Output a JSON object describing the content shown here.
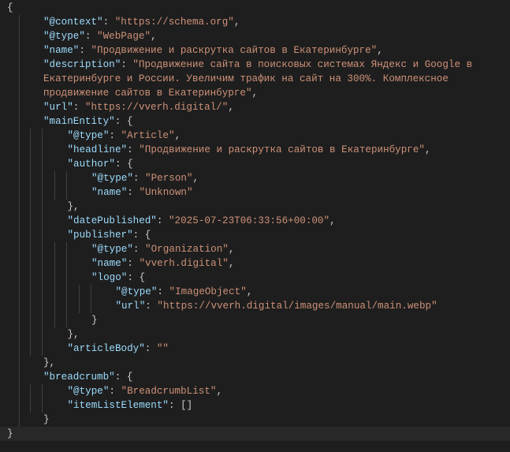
{
  "editor": {
    "current_line": 30,
    "lines": [
      {
        "level": 0,
        "seg": [
          [
            "p",
            "{"
          ]
        ]
      },
      {
        "level": 1,
        "seg": [
          [
            "k",
            "\"@context\""
          ],
          [
            "p",
            ": "
          ],
          [
            "s",
            "\"https://schema.org\""
          ],
          [
            "p",
            ","
          ]
        ]
      },
      {
        "level": 1,
        "seg": [
          [
            "k",
            "\"@type\""
          ],
          [
            "p",
            ": "
          ],
          [
            "s",
            "\"WebPage\""
          ],
          [
            "p",
            ","
          ]
        ]
      },
      {
        "level": 1,
        "seg": [
          [
            "k",
            "\"name\""
          ],
          [
            "p",
            ": "
          ],
          [
            "s",
            "\"Продвижение и раскрутка сайтов в Екатеринбурге\""
          ],
          [
            "p",
            ","
          ]
        ]
      },
      {
        "level": 1,
        "seg": [
          [
            "k",
            "\"description\""
          ],
          [
            "p",
            ": "
          ],
          [
            "s",
            "\"Продвижение сайта в поисковых системах Яндекс и Google в"
          ]
        ]
      },
      {
        "level": 1,
        "seg": [
          [
            "s",
            "Екатеринбурге и России. Увеличим трафик на сайт на 300%. Комплексное"
          ]
        ]
      },
      {
        "level": 1,
        "seg": [
          [
            "s",
            "продвижение сайтов в Екатеринбурге\""
          ],
          [
            "p",
            ","
          ]
        ]
      },
      {
        "level": 1,
        "seg": [
          [
            "k",
            "\"url\""
          ],
          [
            "p",
            ": "
          ],
          [
            "s",
            "\"https://vverh.digital/\""
          ],
          [
            "p",
            ","
          ]
        ]
      },
      {
        "level": 1,
        "seg": [
          [
            "k",
            "\"mainEntity\""
          ],
          [
            "p",
            ": {"
          ]
        ]
      },
      {
        "level": 2,
        "seg": [
          [
            "k",
            "\"@type\""
          ],
          [
            "p",
            ": "
          ],
          [
            "s",
            "\"Article\""
          ],
          [
            "p",
            ","
          ]
        ]
      },
      {
        "level": 2,
        "seg": [
          [
            "k",
            "\"headline\""
          ],
          [
            "p",
            ": "
          ],
          [
            "s",
            "\"Продвижение и раскрутка сайтов в Екатеринбурге\""
          ],
          [
            "p",
            ","
          ]
        ]
      },
      {
        "level": 2,
        "seg": [
          [
            "k",
            "\"author\""
          ],
          [
            "p",
            ": {"
          ]
        ]
      },
      {
        "level": 3,
        "seg": [
          [
            "k",
            "\"@type\""
          ],
          [
            "p",
            ": "
          ],
          [
            "s",
            "\"Person\""
          ],
          [
            "p",
            ","
          ]
        ]
      },
      {
        "level": 3,
        "seg": [
          [
            "k",
            "\"name\""
          ],
          [
            "p",
            ": "
          ],
          [
            "s",
            "\"Unknown\""
          ]
        ]
      },
      {
        "level": 2,
        "seg": [
          [
            "p",
            "},"
          ]
        ]
      },
      {
        "level": 2,
        "seg": [
          [
            "k",
            "\"datePublished\""
          ],
          [
            "p",
            ": "
          ],
          [
            "s",
            "\"2025-07-23T06:33:56+00:00\""
          ],
          [
            "p",
            ","
          ]
        ]
      },
      {
        "level": 2,
        "seg": [
          [
            "k",
            "\"publisher\""
          ],
          [
            "p",
            ": {"
          ]
        ]
      },
      {
        "level": 3,
        "seg": [
          [
            "k",
            "\"@type\""
          ],
          [
            "p",
            ": "
          ],
          [
            "s",
            "\"Organization\""
          ],
          [
            "p",
            ","
          ]
        ]
      },
      {
        "level": 3,
        "seg": [
          [
            "k",
            "\"name\""
          ],
          [
            "p",
            ": "
          ],
          [
            "s",
            "\"vverh.digital\""
          ],
          [
            "p",
            ","
          ]
        ]
      },
      {
        "level": 3,
        "seg": [
          [
            "k",
            "\"logo\""
          ],
          [
            "p",
            ": {"
          ]
        ]
      },
      {
        "level": 4,
        "seg": [
          [
            "k",
            "\"@type\""
          ],
          [
            "p",
            ": "
          ],
          [
            "s",
            "\"ImageObject\""
          ],
          [
            "p",
            ","
          ]
        ]
      },
      {
        "level": 4,
        "seg": [
          [
            "k",
            "\"url\""
          ],
          [
            "p",
            ": "
          ],
          [
            "s",
            "\"https://vverh.digital/images/manual/main.webp\""
          ]
        ]
      },
      {
        "level": 3,
        "seg": [
          [
            "p",
            "}"
          ]
        ]
      },
      {
        "level": 2,
        "seg": [
          [
            "p",
            "},"
          ]
        ]
      },
      {
        "level": 2,
        "seg": [
          [
            "k",
            "\"articleBody\""
          ],
          [
            "p",
            ": "
          ],
          [
            "s",
            "\"\""
          ]
        ]
      },
      {
        "level": 1,
        "seg": [
          [
            "p",
            "},"
          ]
        ]
      },
      {
        "level": 1,
        "seg": [
          [
            "k",
            "\"breadcrumb\""
          ],
          [
            "p",
            ": {"
          ]
        ]
      },
      {
        "level": 2,
        "seg": [
          [
            "k",
            "\"@type\""
          ],
          [
            "p",
            ": "
          ],
          [
            "s",
            "\"BreadcrumbList\""
          ],
          [
            "p",
            ","
          ]
        ]
      },
      {
        "level": 2,
        "seg": [
          [
            "k",
            "\"itemListElement\""
          ],
          [
            "p",
            ": []"
          ]
        ]
      },
      {
        "level": 1,
        "seg": [
          [
            "p",
            "}"
          ]
        ]
      },
      {
        "level": 0,
        "seg": [
          [
            "p",
            "}"
          ]
        ]
      }
    ]
  }
}
